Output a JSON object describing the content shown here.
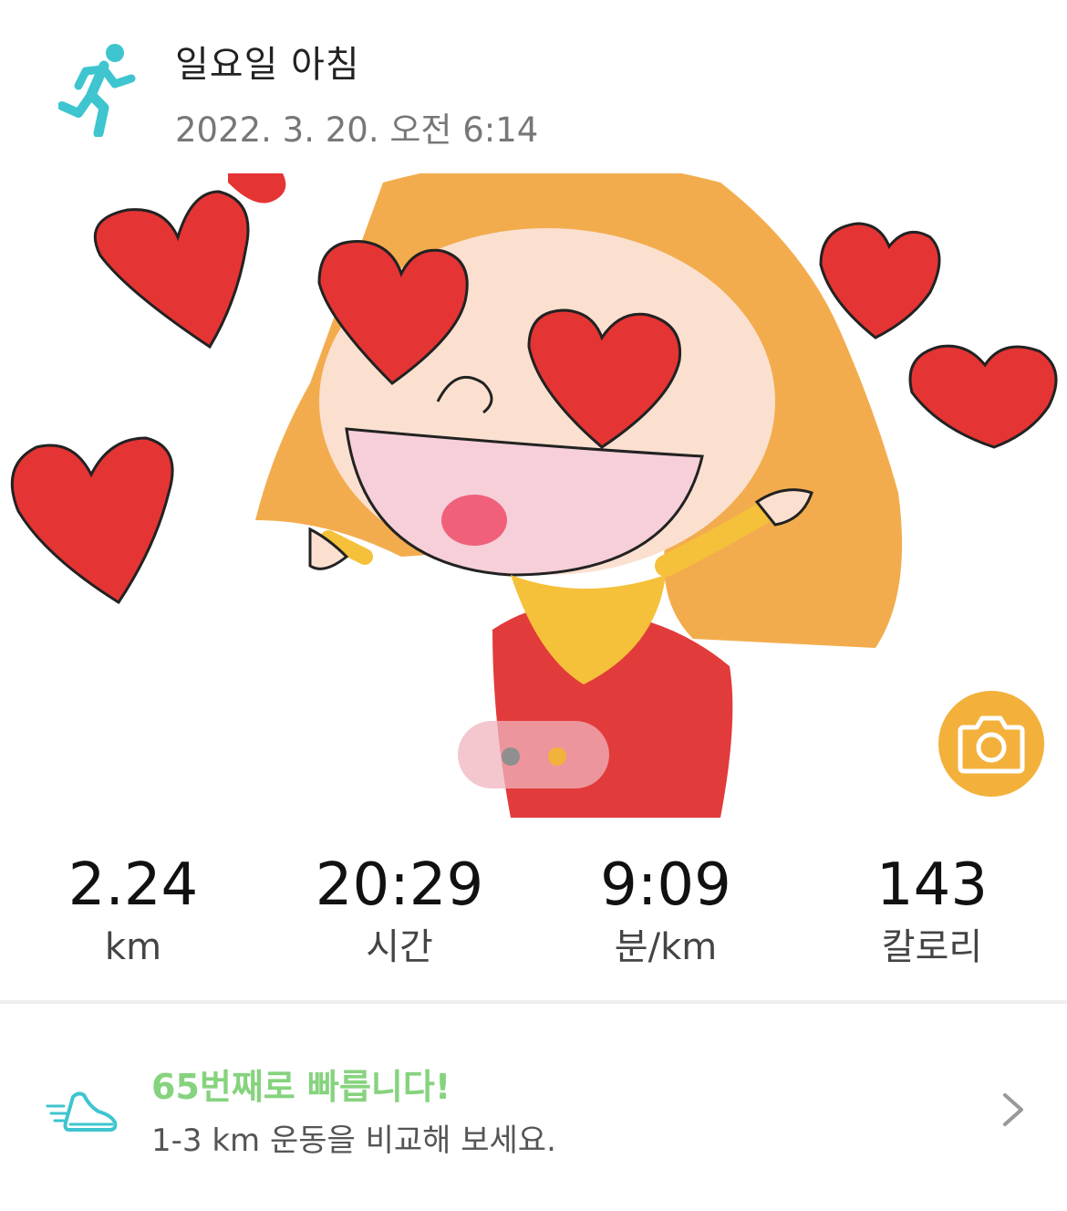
{
  "workout": {
    "title": "일요일 아침",
    "datetime": "2022. 3. 20. 오전 6:14",
    "type_icon": "running-person-icon"
  },
  "hero": {
    "image": "cartoon-girl-with-hearts",
    "pager": {
      "total": 2,
      "active": 2
    },
    "camera_icon": "camera-icon"
  },
  "stats": [
    {
      "value": "2.24",
      "unit": "km"
    },
    {
      "value": "20:29",
      "unit": "시간"
    },
    {
      "value": "9:09",
      "unit": "분/km"
    },
    {
      "value": "143",
      "unit": "칼로리"
    }
  ],
  "comparison": {
    "rank_text": "65번째로 빠릅니다!",
    "subtitle": "1-3 km 운동을 비교해 보세요.",
    "icon": "running-shoe-icon",
    "chevron": "chevron-right-icon"
  },
  "colors": {
    "accent_teal": "#3ec5cf",
    "camera_button": "#f3b13c",
    "rank_green": "#86d37e",
    "pager_inactive": "#8f8f8f",
    "pager_active": "#f2b33c"
  }
}
